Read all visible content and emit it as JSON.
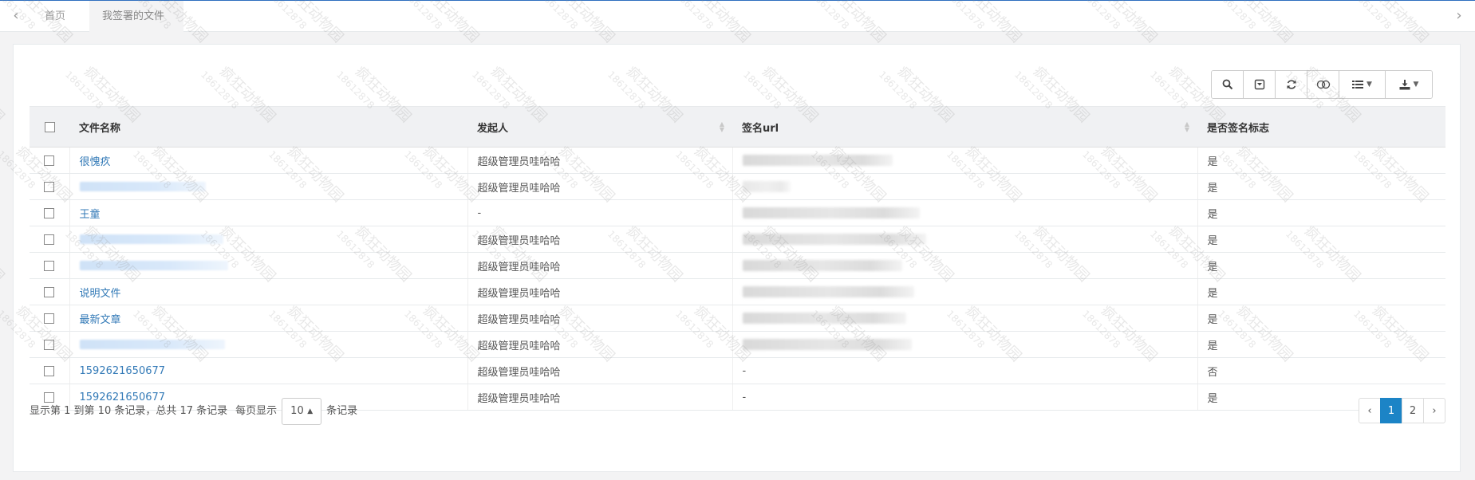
{
  "tabs": {
    "prev_icon": "‹",
    "next_icon": "›",
    "home_label": "首页",
    "active_label": "我签署的文件",
    "close_icon": "✖"
  },
  "toolbar": {
    "icons": [
      "search-icon",
      "filter-icon",
      "refresh-icon",
      "toggle-view-icon",
      "columns-icon",
      "export-icon"
    ]
  },
  "table": {
    "columns": [
      "文件名称",
      "发起人",
      "签名url",
      "是否签名标志"
    ],
    "rows": [
      {
        "file": "很愧疚",
        "initiator": "超级管理员哇哈哈",
        "url": "",
        "signed": "是"
      },
      {
        "file": "",
        "initiator": "超级管理员哇哈哈",
        "url": "",
        "signed": "是"
      },
      {
        "file": "王童",
        "initiator": "-",
        "url": "",
        "signed": "是"
      },
      {
        "file": "",
        "initiator": "超级管理员哇哈哈",
        "url": "",
        "signed": "是"
      },
      {
        "file": "",
        "initiator": "超级管理员哇哈哈",
        "url": "",
        "signed": "是"
      },
      {
        "file": "说明文件",
        "initiator": "超级管理员哇哈哈",
        "url": "",
        "signed": "是"
      },
      {
        "file": "最新文章",
        "initiator": "超级管理员哇哈哈",
        "url": "",
        "signed": "是"
      },
      {
        "file": "",
        "initiator": "超级管理员哇哈哈",
        "url": "",
        "signed": "是"
      },
      {
        "file": "1592621650677",
        "initiator": "超级管理员哇哈哈",
        "url": "-",
        "signed": "否"
      },
      {
        "file": "1592621650677",
        "initiator": "超级管理员哇哈哈",
        "url": "-",
        "signed": "是"
      }
    ]
  },
  "footer": {
    "summary": "显示第 1 到第 10 条记录，总共 17 条记录",
    "per_page_prefix": "每页显示",
    "page_size": "10",
    "per_page_suffix": "条记录",
    "pager": {
      "prev": "‹",
      "pages": [
        "1",
        "2"
      ],
      "current": "1",
      "next": "›"
    }
  },
  "watermark": {
    "text": "疯狂动物园",
    "id": "18612878"
  },
  "colors": {
    "link": "#337ab7",
    "pager_active": "#1c84c6",
    "tab_top": "#2f6fbf"
  }
}
